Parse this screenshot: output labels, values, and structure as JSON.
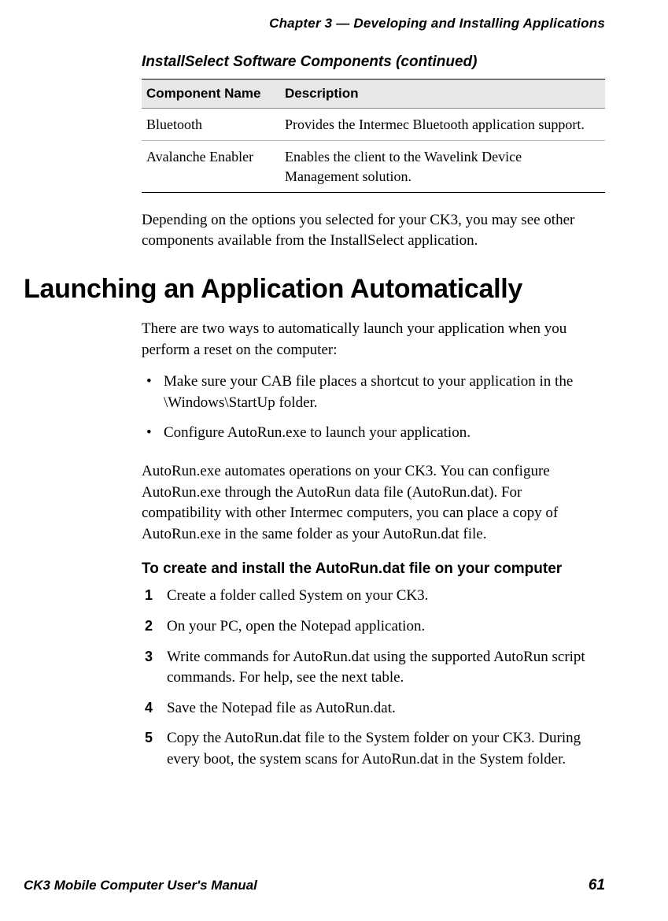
{
  "header": {
    "running": "Chapter 3 — Developing and Installing Applications"
  },
  "table": {
    "caption": "InstallSelect Software Components (continued)",
    "columns": [
      "Component Name",
      "Description"
    ],
    "rows": [
      {
        "name": "Bluetooth",
        "desc": "Provides the Intermec Bluetooth application support."
      },
      {
        "name": "Avalanche Enabler",
        "desc": "Enables the client to the Wavelink Device Management solution."
      }
    ]
  },
  "after_table_para": "Depending on the options you selected for your CK3, you may see other components available from the InstallSelect application.",
  "heading": "Launching an Application Automatically",
  "intro_para": "There are two ways to automatically launch your application when you perform a reset on the computer:",
  "bullets": [
    "Make sure your CAB file places a shortcut to your application in the \\Windows\\StartUp folder.",
    "Configure AutoRun.exe to launch your application."
  ],
  "autorun_para": "AutoRun.exe automates operations on your CK3. You can configure AutoRun.exe through the AutoRun data file (AutoRun.dat). For compatibility with other Intermec computers, you can place a copy of AutoRun.exe in the same folder as your AutoRun.dat file.",
  "subhead": "To create and install the AutoRun.dat file on your computer",
  "steps": [
    "Create a folder called System on your CK3.",
    "On your PC, open the Notepad application.",
    "Write commands for AutoRun.dat using the supported AutoRun script commands. For help, see the next table.",
    "Save the Notepad file as AutoRun.dat.",
    "Copy the AutoRun.dat file to the System folder on your CK3. During every boot, the system scans for AutoRun.dat in the System folder."
  ],
  "footer": {
    "title": "CK3 Mobile Computer User's Manual",
    "page": "61"
  }
}
